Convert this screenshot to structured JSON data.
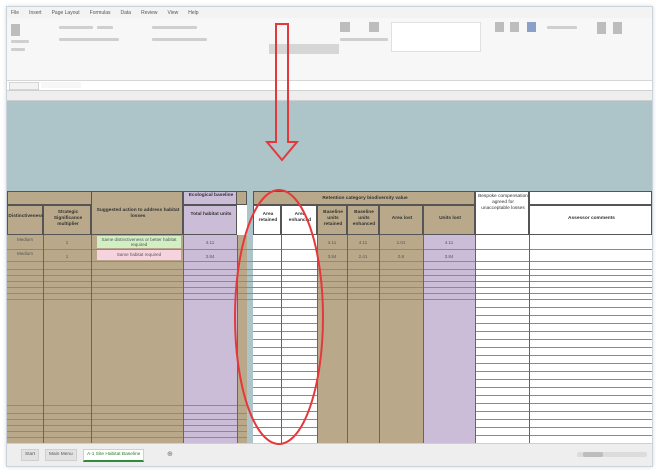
{
  "menu": [
    "File",
    "Insert",
    "Page Layout",
    "Formulas",
    "Data",
    "Review",
    "View",
    "Help"
  ],
  "table": {
    "headers": {
      "distinctiveness": "Distinctiveness",
      "strategic": "Strategic Significance multiplier",
      "suggested": "Suggested action to address habitat losses",
      "bio_units_group": "Ecological baseline",
      "total_units": "Total habitat units",
      "retention_group": "Retention category biodiversity value",
      "area_retained": "Area retained",
      "area_enhanced": "Area enhanced",
      "units_retained": "Baseline units retained",
      "units_enhanced": "Baseline units enhanced",
      "area_lost": "Area lost",
      "units_lost": "Units lost",
      "bespoke": "Bespoke compensation agreed for unacceptable losses",
      "comments": "Assessor comments"
    },
    "rows": [
      {
        "distinct": "Medium",
        "strategic": "1",
        "action": "Same distinctiveness or better habitat required",
        "total": "4.11",
        "u_ret": "4.11",
        "u_enh": "4.11",
        "a_lost": "1.01",
        "u_lost": "4.11"
      },
      {
        "distinct": "Medium",
        "strategic": "1",
        "action": "Same habitat required",
        "total": "3.84",
        "u_ret": "3.84",
        "u_enh": "2.41",
        "a_lost": "0.8",
        "u_lost": "3.84"
      }
    ]
  },
  "sheet_tabs": [
    {
      "label": "Start",
      "active": false
    },
    {
      "label": "Main Menu",
      "active": false
    },
    {
      "label": "A-1 Site Habitat Baseline",
      "active": true
    }
  ],
  "colors": {
    "tan": "#b9a98a",
    "lavender": "#cbbcd8",
    "green": "#d2efc4",
    "pink": "#f7d3df",
    "annotation": "#e5383b"
  }
}
